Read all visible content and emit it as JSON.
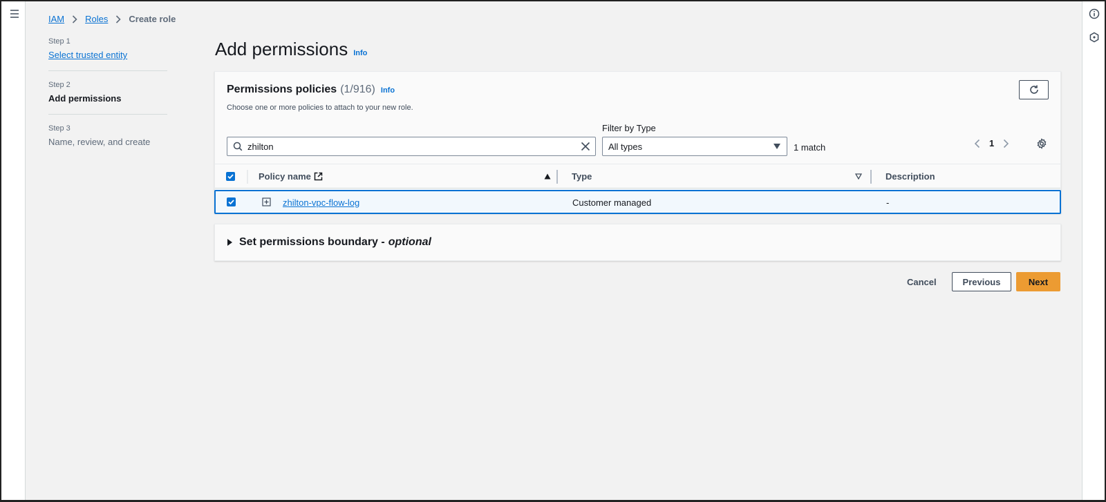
{
  "breadcrumb": {
    "items": [
      {
        "label": "IAM"
      },
      {
        "label": "Roles"
      }
    ],
    "current": "Create role"
  },
  "steps": [
    {
      "number": "Step 1",
      "title": "Select trusted entity"
    },
    {
      "number": "Step 2",
      "title": "Add permissions"
    },
    {
      "number": "Step 3",
      "title": "Name, review, and create"
    }
  ],
  "page": {
    "title": "Add permissions",
    "info": "Info"
  },
  "policies": {
    "title": "Permissions policies",
    "count": "(1/916)",
    "info": "Info",
    "description": "Choose one or more policies to attach to your new role.",
    "search_value": "zhilton",
    "filter_label": "Filter by Type",
    "filter_value": "All types",
    "match_count": "1 match",
    "page_number": "1",
    "columns": {
      "policy_name": "Policy name",
      "type": "Type",
      "description": "Description"
    },
    "rows": [
      {
        "policy_name": "zhilton-vpc-flow-log",
        "type": "Customer managed",
        "description": "-"
      }
    ]
  },
  "boundary": {
    "title": "Set permissions boundary -",
    "optional": "optional"
  },
  "actions": {
    "cancel": "Cancel",
    "previous": "Previous",
    "next": "Next"
  },
  "colors": {
    "link": "#0972d3",
    "primary_button": "#ec9b32",
    "selection_border": "#0972d3"
  },
  "icons": [
    "menu-icon",
    "info-circle-icon",
    "hexagon-icon",
    "chevron-right-icon",
    "refresh-icon",
    "search-icon",
    "clear-icon",
    "caret-down-icon",
    "chevron-left-icon",
    "settings-icon",
    "external-link-icon",
    "sort-ascending-icon",
    "sort-descending-icon",
    "expand-icon",
    "checkbox-checked-icon",
    "caret-right-icon"
  ]
}
